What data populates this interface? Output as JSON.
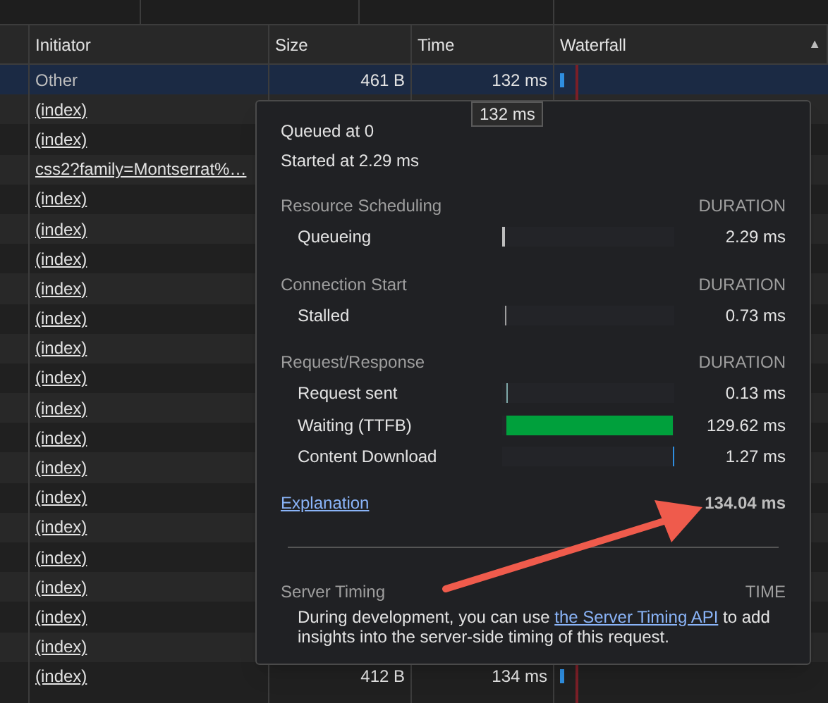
{
  "table": {
    "columns": [
      "Initiator",
      "Size",
      "Time",
      "Waterfall"
    ],
    "rows": [
      {
        "initiator": "Other",
        "kind": "plain",
        "size": "461 B",
        "time": "132 ms",
        "selected": true
      },
      {
        "initiator": "(index)",
        "kind": "link",
        "selected": false
      },
      {
        "initiator": "(index)",
        "kind": "link",
        "selected": false
      },
      {
        "initiator": "css2?family=Montserrat%…",
        "kind": "link",
        "selected": false
      },
      {
        "initiator": "(index)",
        "kind": "link",
        "selected": false
      },
      {
        "initiator": "(index)",
        "kind": "link",
        "selected": false
      },
      {
        "initiator": "(index)",
        "kind": "link",
        "selected": false
      },
      {
        "initiator": "(index)",
        "kind": "link",
        "selected": false
      },
      {
        "initiator": "(index)",
        "kind": "link",
        "selected": false
      },
      {
        "initiator": "(index)",
        "kind": "link",
        "selected": false
      },
      {
        "initiator": "(index)",
        "kind": "link",
        "selected": false
      },
      {
        "initiator": "(index)",
        "kind": "link",
        "selected": false
      },
      {
        "initiator": "(index)",
        "kind": "link",
        "selected": false
      },
      {
        "initiator": "(index)",
        "kind": "link",
        "selected": false
      },
      {
        "initiator": "(index)",
        "kind": "link",
        "selected": false
      },
      {
        "initiator": "(index)",
        "kind": "link",
        "selected": false
      },
      {
        "initiator": "(index)",
        "kind": "link",
        "selected": false
      },
      {
        "initiator": "(index)",
        "kind": "link",
        "selected": false
      },
      {
        "initiator": "(index)",
        "kind": "link",
        "selected": false
      },
      {
        "initiator": "(index)",
        "kind": "link",
        "selected": false
      },
      {
        "initiator": "(index)",
        "kind": "link",
        "size": "412 B",
        "time": "134 ms",
        "selected": false
      }
    ],
    "sort_icon": "▲"
  },
  "waterfall_tooltip": "132 ms",
  "timing": {
    "queued": "Queued at 0",
    "started": "Started at 2.29 ms",
    "sections": [
      {
        "title": "Resource Scheduling",
        "column_label": "DURATION",
        "rows": [
          {
            "label": "Queueing",
            "value": "2.29 ms",
            "level": 0.017,
            "color": "#bdbdbd"
          }
        ]
      },
      {
        "title": "Connection Start",
        "column_label": "DURATION",
        "rows": [
          {
            "label": "Stalled",
            "value": "0.73 ms",
            "level": 0.005,
            "color": "#9e9e9e"
          }
        ]
      },
      {
        "title": "Request/Response",
        "column_label": "DURATION",
        "rows": [
          {
            "label": "Request sent",
            "value": "0.13 ms",
            "level": 0.001,
            "color": "#7fa8a8"
          },
          {
            "label": "Waiting (TTFB)",
            "value": "129.62 ms",
            "level": 0.967,
            "color": "#00a03c"
          },
          {
            "label": "Content Download",
            "value": "1.27 ms",
            "level": 0.0095,
            "color": "#2f8ee0"
          }
        ]
      }
    ],
    "explanation_link": "Explanation",
    "total": "134.04 ms",
    "server_timing": {
      "title": "Server Timing",
      "column_label": "TIME",
      "text_before": "During development, you can use ",
      "link": "the Server Timing API",
      "text_after": " to add insights into the server-side timing of this request."
    }
  }
}
